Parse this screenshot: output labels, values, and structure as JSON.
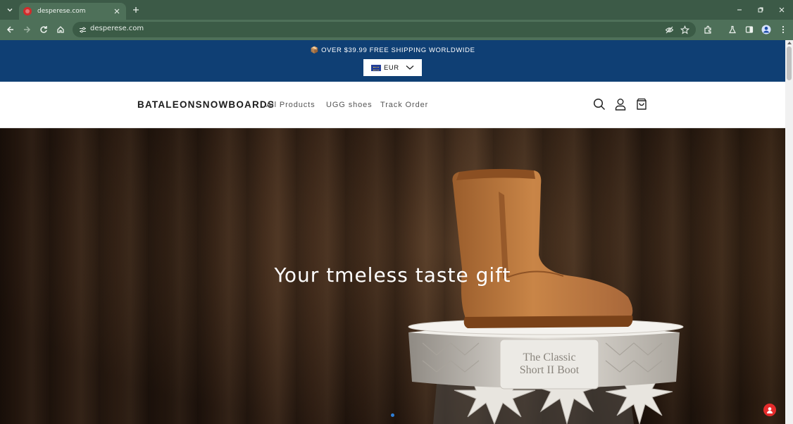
{
  "browser": {
    "tab_title": "desperese.com",
    "url": "desperese.com"
  },
  "announcement": {
    "text": "📦 OVER $39.99 FREE SHIPPING WORLDWIDE"
  },
  "currency": {
    "code": "EUR",
    "flag": "eu-flag-icon"
  },
  "header": {
    "logo": "BATALEONSNOWBOARDS",
    "nav": [
      {
        "label": "All Products"
      },
      {
        "label": "UGG shoes"
      },
      {
        "label": "Track Order"
      }
    ]
  },
  "hero": {
    "heading": "Your tmeless taste gift",
    "pedestal_text_line1": "The Classic",
    "pedestal_text_line2": "Short II Boot"
  },
  "colors": {
    "chrome_tabbar": "#3c5a47",
    "chrome_toolbar": "#4e7059",
    "announcement_bg": "#0f3f74",
    "accent_dot": "#2f7fd8",
    "chat_button": "#e52c2c"
  }
}
